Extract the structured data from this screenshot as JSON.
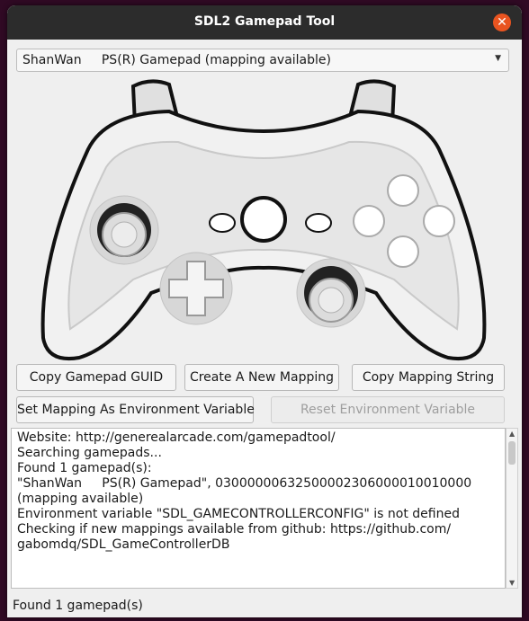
{
  "window": {
    "title": "SDL2 Gamepad Tool"
  },
  "gamepad_select": {
    "value": "ShanWan     PS(R) Gamepad (mapping available)"
  },
  "buttons": {
    "copy_guid": "Copy Gamepad GUID",
    "create_mapping": "Create A New Mapping",
    "copy_mapping": "Copy Mapping String",
    "set_env": "Set Mapping As Environment Variable",
    "reset_env": "Reset Environment Variable"
  },
  "log": {
    "lines": [
      "Website: http://generealarcade.com/gamepadtool/",
      "",
      "Searching gamepads...",
      "Found 1 gamepad(s):",
      "\"ShanWan     PS(R) Gamepad\", 030000006325000023060000100100​00\n(mapping available)",
      "Environment variable \"SDL_GAMECONTROLLERCONFIG\" is not defined",
      "Checking if new mappings available from github: https://github.com/\ngabomdq/SDL_GameControllerDB"
    ]
  },
  "status": "Found 1 gamepad(s)",
  "colors": {
    "titlebar": "#2c2c2c",
    "close": "#e95420",
    "window_bg": "#efefef"
  }
}
